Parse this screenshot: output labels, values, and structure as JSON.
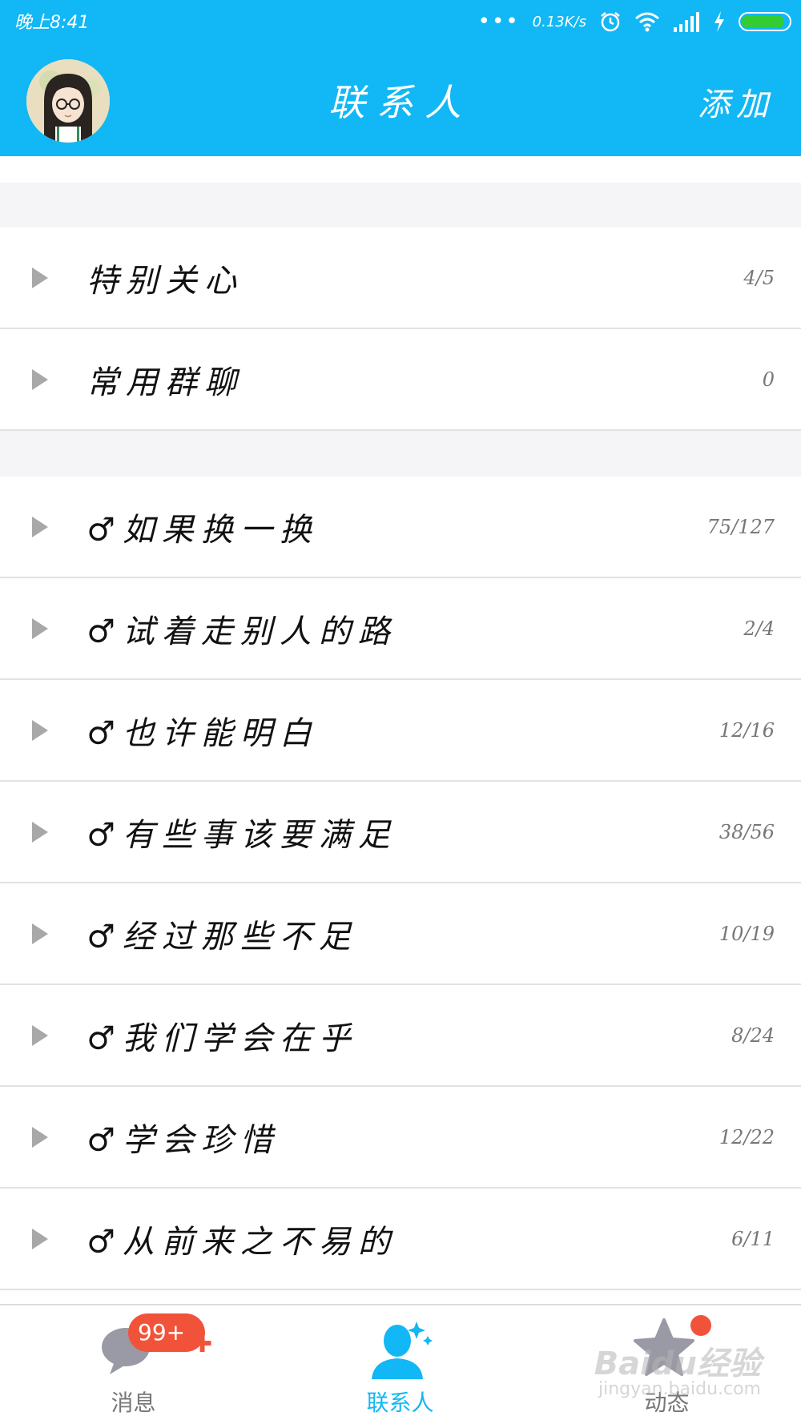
{
  "status_bar": {
    "time": "晚上8:41",
    "dots": "•••",
    "net_speed": "0.13K/s"
  },
  "header": {
    "title": "联系人",
    "add_label": "添加",
    "accent_color": "#12b7f5"
  },
  "groups_top": [
    {
      "name": "特别关心",
      "count": "4/5"
    },
    {
      "name": "常用群聊",
      "count": "0"
    }
  ],
  "groups": [
    {
      "name": "♂如果换一换",
      "count": "75/127"
    },
    {
      "name": "♂试着走别人的路",
      "count": "2/4"
    },
    {
      "name": "♂也许能明白",
      "count": "12/16"
    },
    {
      "name": "♂有些事该要满足",
      "count": "38/56"
    },
    {
      "name": "♂经过那些不足",
      "count": "10/19"
    },
    {
      "name": "♂我们学会在乎",
      "count": "8/24"
    },
    {
      "name": "♂学会珍惜",
      "count": "12/22"
    },
    {
      "name": "♂从前来之不易的",
      "count": "6/11"
    }
  ],
  "bottom_nav": {
    "messages_label": "消息",
    "messages_badge": "99+",
    "contacts_label": "联系人",
    "feed_label": "动态"
  },
  "watermark": {
    "brand": "Baidu经验",
    "url": "jingyan.baidu.com"
  },
  "icons": {
    "alarm": "alarm-icon",
    "wifi": "wifi-icon",
    "signal": "signal-icon",
    "charging": "lightning-icon",
    "battery": "battery-icon",
    "arrow": "expand-arrow-icon",
    "messages": "chat-bubble-icon",
    "contacts": "person-icon",
    "feed": "star-icon"
  },
  "battery_level": 0.92
}
